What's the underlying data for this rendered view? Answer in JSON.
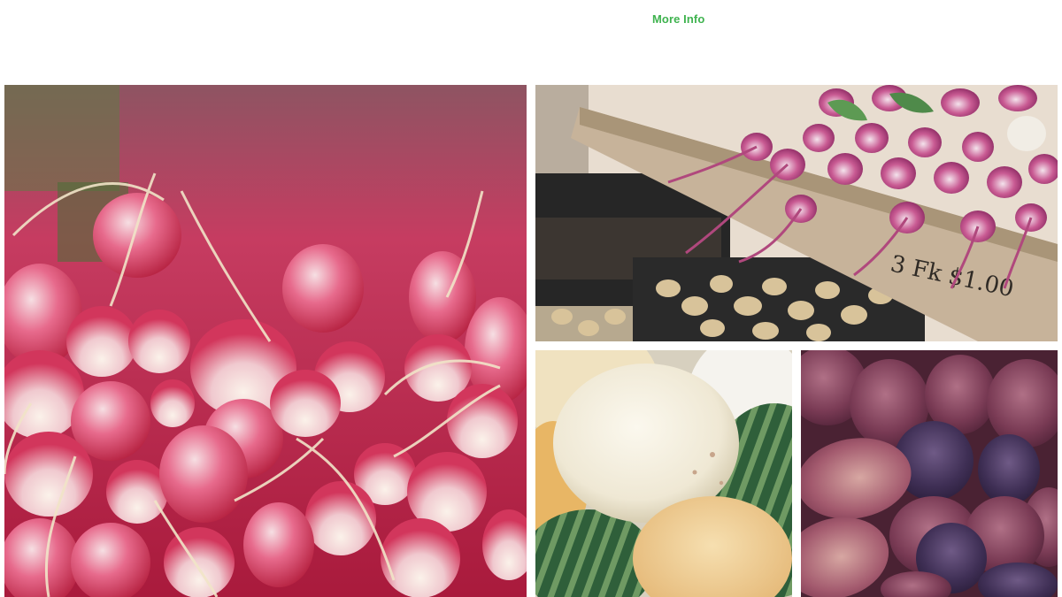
{
  "header": {
    "more_info_label": "More Info",
    "link_color": "#3fb34f"
  },
  "gallery": {
    "images": [
      {
        "subject": "radishes-closeup",
        "icon": "radish-image"
      },
      {
        "subject": "radishes-in-wooden-crate",
        "crate_label": "3 Fk $1.00",
        "icon": "radish-crate-image"
      },
      {
        "subject": "melons-and-watermelons",
        "icon": "melon-image"
      },
      {
        "subject": "figs",
        "icon": "fig-image"
      }
    ]
  }
}
